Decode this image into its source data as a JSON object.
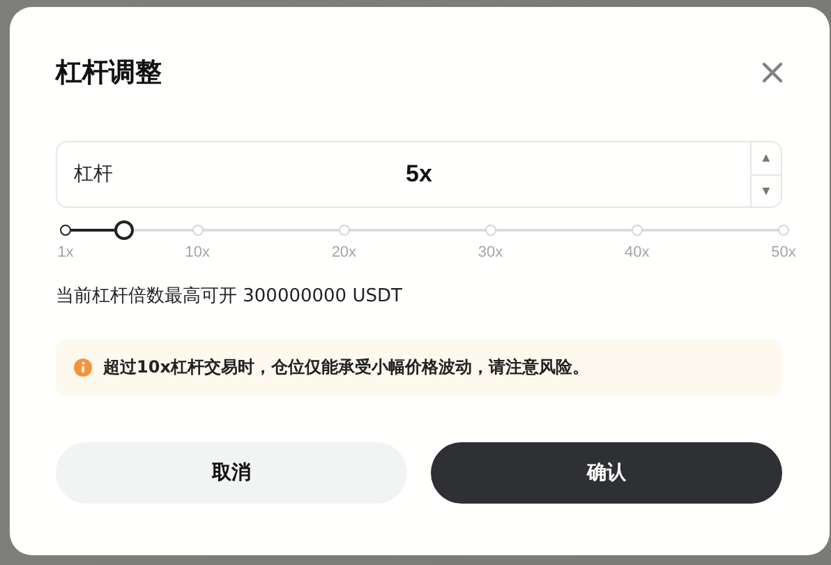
{
  "dialog": {
    "title": "杠杆调整",
    "leverage_field": {
      "label": "杠杆",
      "value": "5x",
      "up": "▲",
      "down": "▼"
    },
    "slider": {
      "level": 0.0816,
      "ticks": [
        "1x",
        "10x",
        "20x",
        "30x",
        "40x",
        "50x"
      ]
    },
    "max_note": "当前杠杆倍数最高可开 300000000 USDT",
    "warning": {
      "text": "超过**10x**杠杆交易时，仓位仅能承受小幅价格波动，请注意风险。"
    },
    "buttons": [
      {
        "label": "取消",
        "kind": "secondary"
      },
      {
        "label": "确认",
        "kind": "primary"
      }
    ]
  }
}
